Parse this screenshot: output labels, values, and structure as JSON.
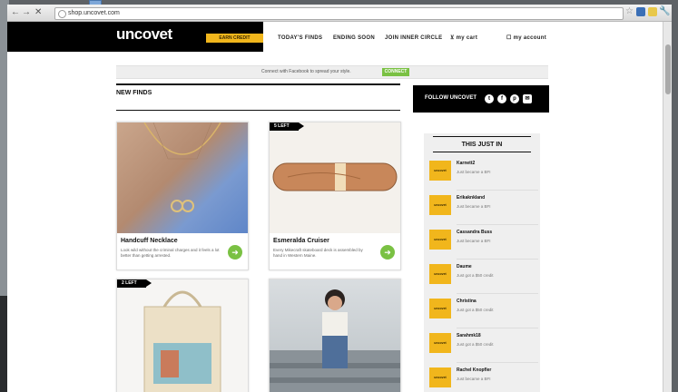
{
  "browser": {
    "url": "shop.uncovet.com",
    "nav": {
      "back": "←",
      "forward": "→",
      "stop": "✕",
      "star": "☆",
      "wrench": "🔧"
    }
  },
  "header": {
    "logo": "uncovet",
    "earn_credit": "EARN CREDIT",
    "nav": [
      "TODAY'S FINDS",
      "ENDING SOON",
      "JOIN INNER CIRCLE"
    ],
    "cart": "my cart",
    "account": "my account"
  },
  "facebook_bar": {
    "text": "Connect with Facebook to spread your style.",
    "button": "CONNECT"
  },
  "section_title": "NEW FINDS",
  "follow": {
    "label": "FOLLOW UNCOVET",
    "icons": [
      "t",
      "f",
      "p",
      "✉"
    ]
  },
  "products": [
    {
      "title": "Handcuff Necklace",
      "desc": "Look wild without the criminal charges and it feels a lot better than getting arrested.",
      "tag": ""
    },
    {
      "title": "Esmeralda Cruiser",
      "desc": "Every Mikecraft skateboard deck is assembled by hand in Western Maine.",
      "tag": "5 LEFT"
    },
    {
      "title": "",
      "desc": "",
      "tag": "2 LEFT"
    },
    {
      "title": "",
      "desc": "",
      "tag": ""
    }
  ],
  "this_just_in": {
    "title": "THIS JUST IN",
    "avatar_label": "uncovet",
    "items": [
      {
        "name": "Karnett2",
        "status": "Just became a BFI"
      },
      {
        "name": "Erikaknkland",
        "status": "Just became a BFI"
      },
      {
        "name": "Cassandra Buss",
        "status": "Just became a BFI"
      },
      {
        "name": "Daume",
        "status": "Just got a $50 credit"
      },
      {
        "name": "Christina",
        "status": "Just got a $50 credit"
      },
      {
        "name": "Sarahmk18",
        "status": "Just got a $50 credit"
      },
      {
        "name": "Rachel Knopfler",
        "status": "Just became a BFI"
      }
    ]
  },
  "colors": {
    "accent_yellow": "#f1b61c",
    "go_green": "#7ac143",
    "black": "#000000"
  }
}
